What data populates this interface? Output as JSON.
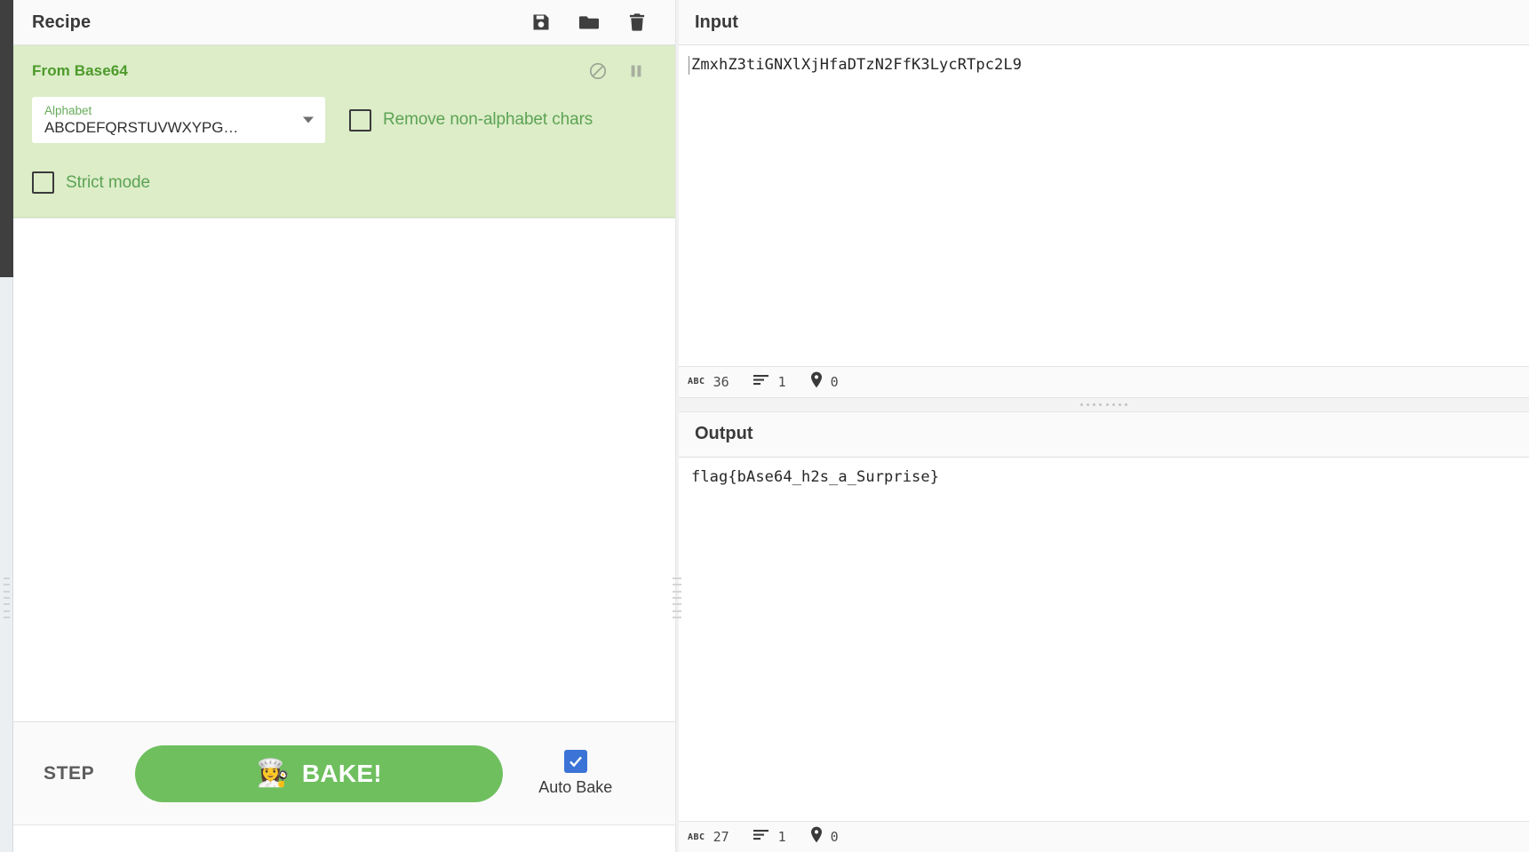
{
  "recipe": {
    "title": "Recipe",
    "controls": [
      {
        "name": "save",
        "label": "Save recipe"
      },
      {
        "name": "load",
        "label": "Load recipe"
      },
      {
        "name": "clear",
        "label": "Clear recipe"
      }
    ],
    "operations": [
      {
        "title": "From Base64",
        "icons": [
          {
            "name": "disable",
            "label": "Disable operation"
          },
          {
            "name": "breakpoint",
            "label": "Set breakpoint"
          }
        ],
        "args": {
          "alphabet_label": "Alphabet",
          "alphabet_value": "ABCDEFQRSTUVWXYPG…",
          "remove_non_alphabet_label": "Remove non-alphabet chars",
          "remove_non_alphabet_checked": false,
          "strict_mode_label": "Strict mode",
          "strict_mode_checked": false
        }
      }
    ]
  },
  "controls_bar": {
    "step_label": "STEP",
    "bake_label": "BAKE!",
    "bake_emoji": "👩‍🍳",
    "auto_bake_label": "Auto Bake",
    "auto_bake_checked": true,
    "bake_color": "#6fbf5f"
  },
  "input": {
    "title": "Input",
    "value": "ZmxhZ3tiGNXlXjHfaDTzN2FfK3LycRTpc2L9",
    "status": {
      "length_icon": "ABC",
      "length": "36",
      "lines_icon": "lines-icon",
      "lines": "1",
      "position_icon": "location-pin-icon",
      "position": "0"
    }
  },
  "output": {
    "title": "Output",
    "value": "flag{bAse64_h2s_a_Surprise}",
    "status": {
      "length_icon": "ABC",
      "length": "27",
      "lines_icon": "lines-icon",
      "lines": "1",
      "position_icon": "location-pin-icon",
      "position": "0"
    }
  },
  "theme": {
    "operation_bg": "#dcedc8",
    "operation_title_color": "#4c9a2a",
    "accent_blue": "#3b74d6"
  }
}
